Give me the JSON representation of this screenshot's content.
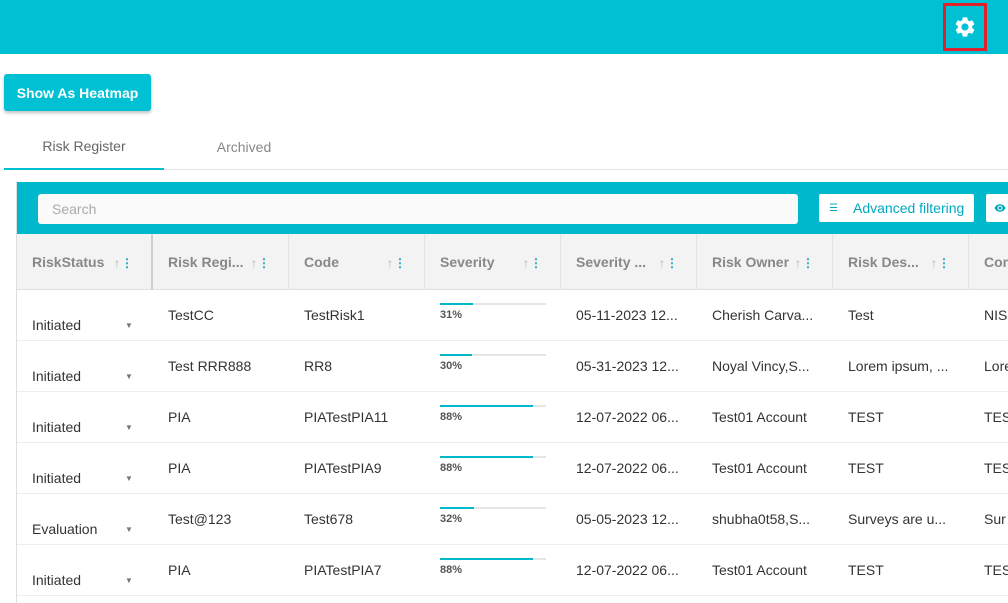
{
  "topbar": {
    "settings_icon": "gear-icon",
    "bg_color": "#00c0d4"
  },
  "heatmap_button": {
    "label": "Show As Heatmap"
  },
  "tabs": [
    {
      "label": "Risk Register",
      "active": true
    },
    {
      "label": "Archived",
      "active": false
    }
  ],
  "toolbar": {
    "search_placeholder": "Search",
    "advanced_filter_label": "Advanced filtering",
    "filter_icon": "filter-icon",
    "view_icon": "eye-icon"
  },
  "columns": [
    "RiskStatus",
    "Risk Regi...",
    "Code",
    "Severity",
    "Severity ...",
    "Risk Owner",
    "Risk Des...",
    "Con"
  ],
  "rows": [
    {
      "status": "Initiated",
      "register": "TestCC",
      "code": "TestRisk1",
      "severity": 31,
      "severity_label": "31%",
      "severity_date": "05-11-2023 12...",
      "owner": "Cherish Carva...",
      "description": "Test",
      "con": "NIS"
    },
    {
      "status": "Initiated",
      "register": "Test RRR888",
      "code": "RR8",
      "severity": 30,
      "severity_label": "30%",
      "severity_date": "05-31-2023 12...",
      "owner": "Noyal Vincy,S...",
      "description": "Lorem ipsum, ...",
      "con": "Lore"
    },
    {
      "status": "Initiated",
      "register": "PIA",
      "code": "PIATestPIA11",
      "severity": 88,
      "severity_label": "88%",
      "severity_date": "12-07-2022 06...",
      "owner": "Test01 Account",
      "description": "TEST",
      "con": "TES"
    },
    {
      "status": "Initiated",
      "register": "PIA",
      "code": "PIATestPIA9",
      "severity": 88,
      "severity_label": "88%",
      "severity_date": "12-07-2022 06...",
      "owner": "Test01 Account",
      "description": "TEST",
      "con": "TES"
    },
    {
      "status": "Evaluation",
      "register": "Test@123",
      "code": "Test678",
      "severity": 32,
      "severity_label": "32%",
      "severity_date": "05-05-2023 12...",
      "owner": "shubha0t58,S...",
      "description": "Surveys are u...",
      "con": "Sur"
    },
    {
      "status": "Initiated",
      "register": "PIA",
      "code": "PIATestPIA7",
      "severity": 88,
      "severity_label": "88%",
      "severity_date": "12-07-2022 06...",
      "owner": "Test01 Account",
      "description": "TEST",
      "con": "TES"
    }
  ]
}
